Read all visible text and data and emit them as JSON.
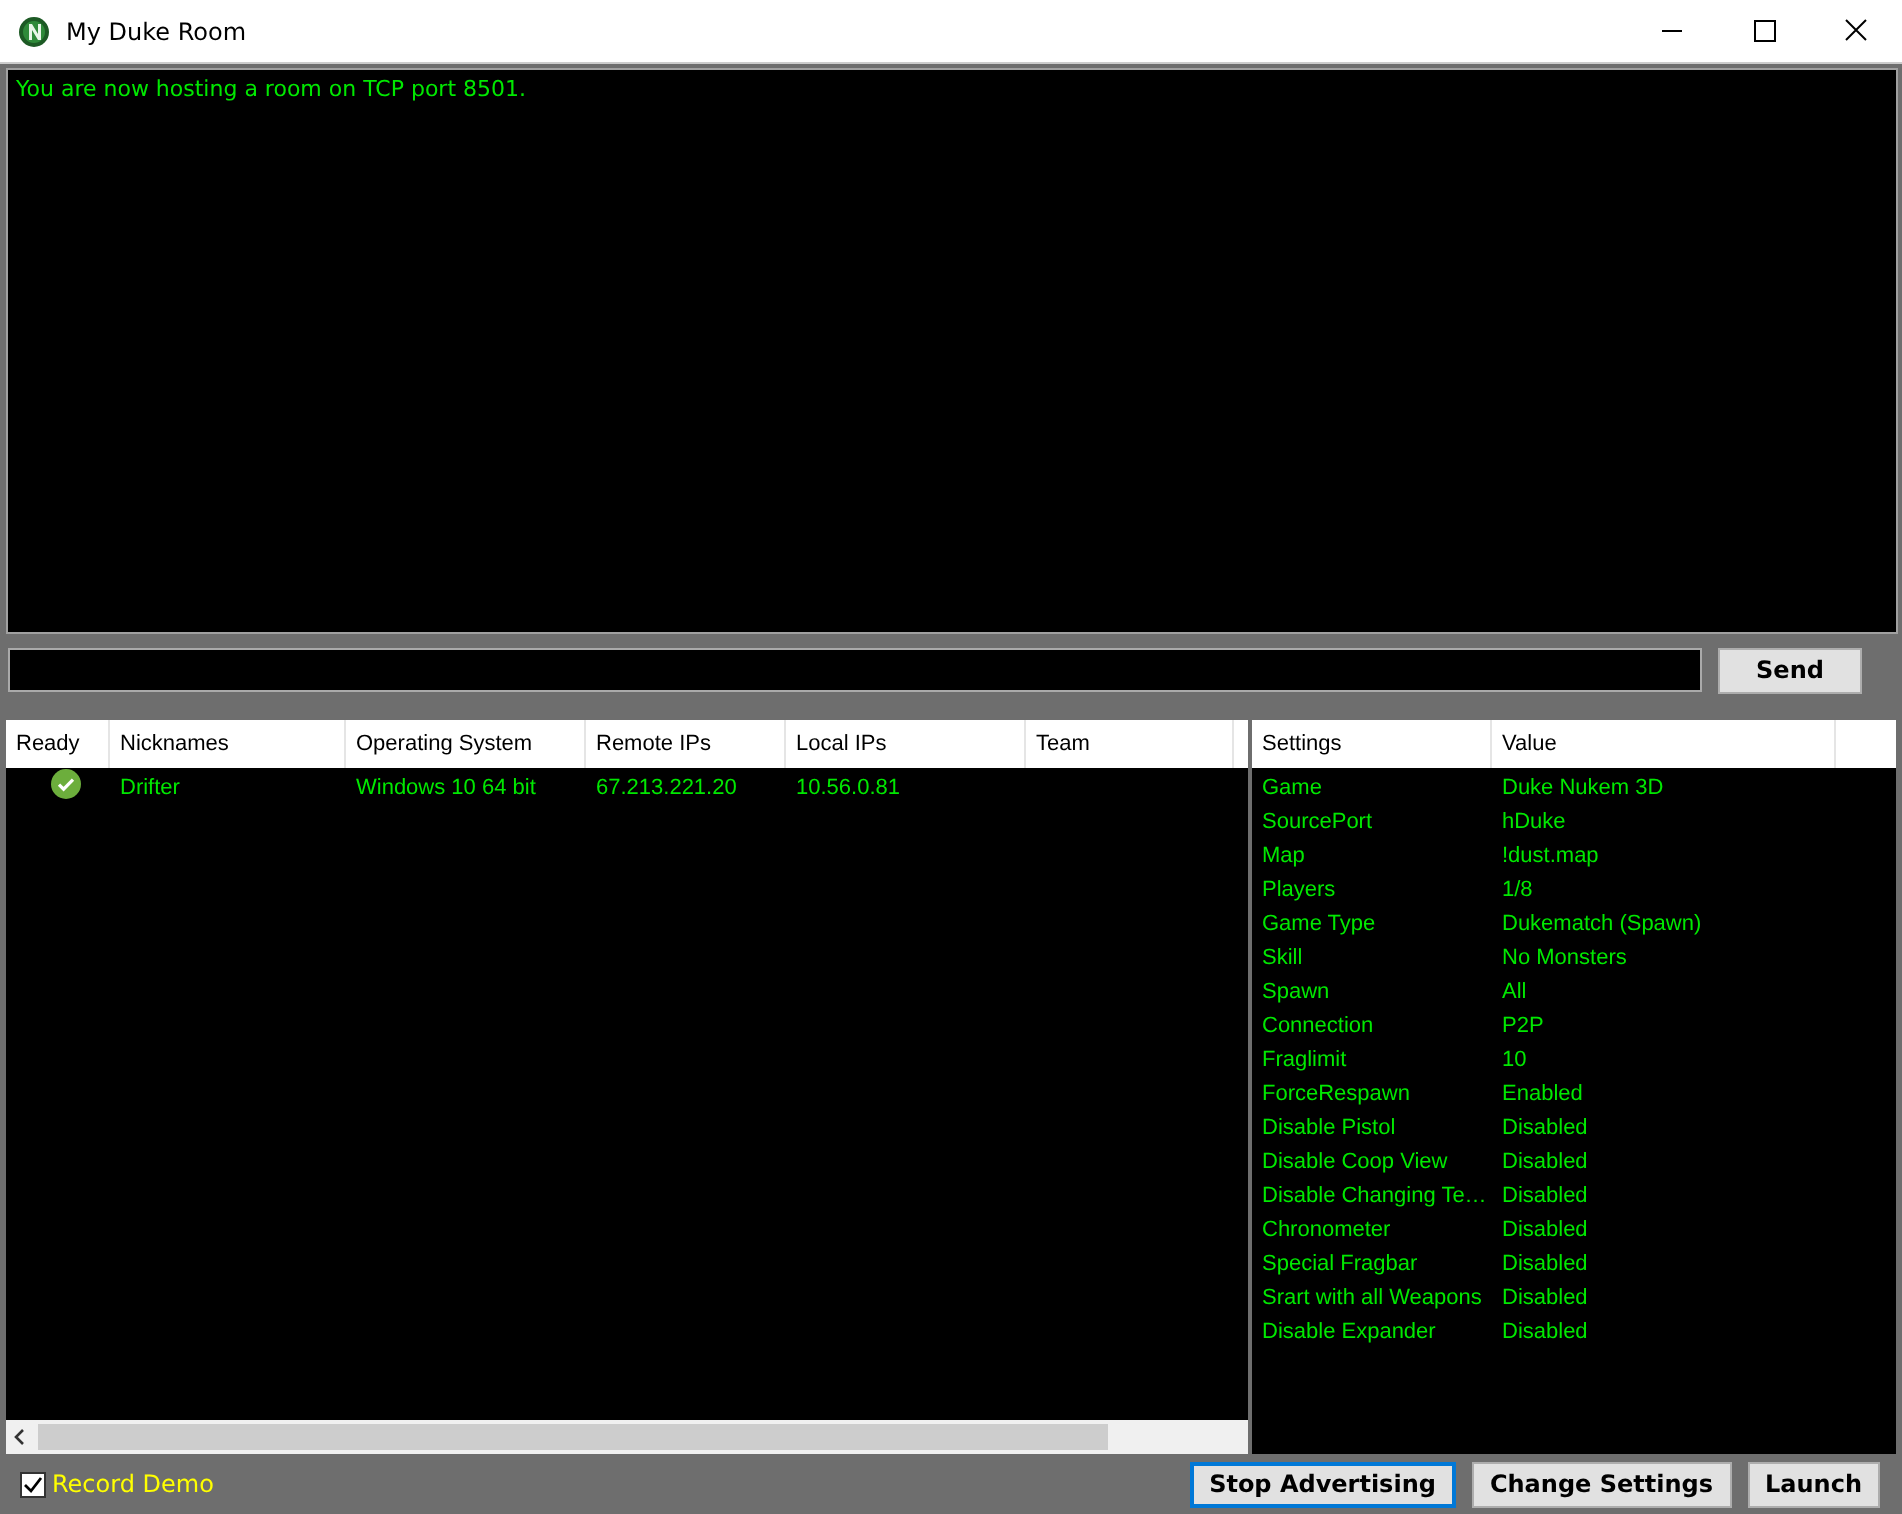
{
  "window": {
    "title": "My Duke Room"
  },
  "log": [
    "You are now hosting a room on TCP port 8501."
  ],
  "chat": {
    "send_button": "Send"
  },
  "players": {
    "columns": [
      "Ready",
      "Nicknames",
      "Operating System",
      "Remote IPs",
      "Local IPs",
      "Team",
      ""
    ],
    "rows": [
      {
        "ready": true,
        "cells": [
          "",
          "Drifter",
          "Windows 10 64 bit",
          "67.213.221.20",
          "10.56.0.81",
          ""
        ]
      }
    ]
  },
  "settings": {
    "columns": [
      "Settings",
      "Value"
    ],
    "rows": [
      [
        "Game",
        "Duke Nukem 3D"
      ],
      [
        "SourcePort",
        "hDuke"
      ],
      [
        "Map",
        "!dust.map"
      ],
      [
        "Players",
        "1/8"
      ],
      [
        "Game Type",
        "Dukematch (Spawn)"
      ],
      [
        "Skill",
        "No Monsters"
      ],
      [
        "Spawn",
        "All"
      ],
      [
        "Connection",
        "P2P"
      ],
      [
        "Fraglimit",
        "10"
      ],
      [
        "ForceRespawn",
        "Enabled"
      ],
      [
        "Disable Pistol",
        "Disabled"
      ],
      [
        "Disable Coop View",
        "Disabled"
      ],
      [
        "Disable Changing Te…",
        "Disabled"
      ],
      [
        "Chronometer",
        "Disabled"
      ],
      [
        "Special Fragbar",
        "Disabled"
      ],
      [
        "Srart with all Weapons",
        "Disabled"
      ],
      [
        "Disable Expander",
        "Disabled"
      ]
    ]
  },
  "record_demo": {
    "label": "Record Demo",
    "checked": true
  },
  "buttons": [
    {
      "label": "Stop Advertising",
      "focused": true
    },
    {
      "label": "Change Settings",
      "focused": false
    },
    {
      "label": "Launch",
      "focused": false
    }
  ]
}
